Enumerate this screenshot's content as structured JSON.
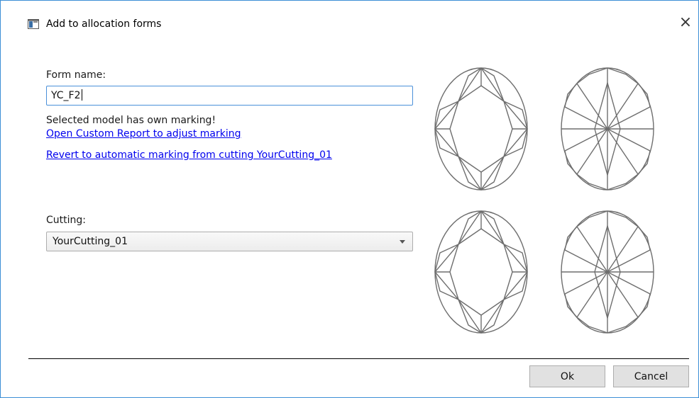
{
  "window": {
    "title": "Add to allocation forms",
    "close_symbol": "×"
  },
  "form": {
    "form_name_label": "Form name:",
    "form_name_value": "YC_F2",
    "marking_message": "Selected model has own marking!",
    "open_report_link": "Open Custom Report to adjust marking",
    "revert_link": "Revert to automatic marking from cutting YourCutting_01",
    "cutting_label": "Cutting:",
    "cutting_value": "YourCutting_01"
  },
  "gem_views": [
    {
      "name": "crown-view"
    },
    {
      "name": "pavilion-view"
    },
    {
      "name": "crown-view"
    },
    {
      "name": "pavilion-view"
    }
  ],
  "buttons": {
    "ok_label": "Ok",
    "cancel_label": "Cancel"
  },
  "colors": {
    "accent": "#3c8fd6",
    "link": "#0000ee",
    "gem_outline": "#6e6e6e"
  }
}
